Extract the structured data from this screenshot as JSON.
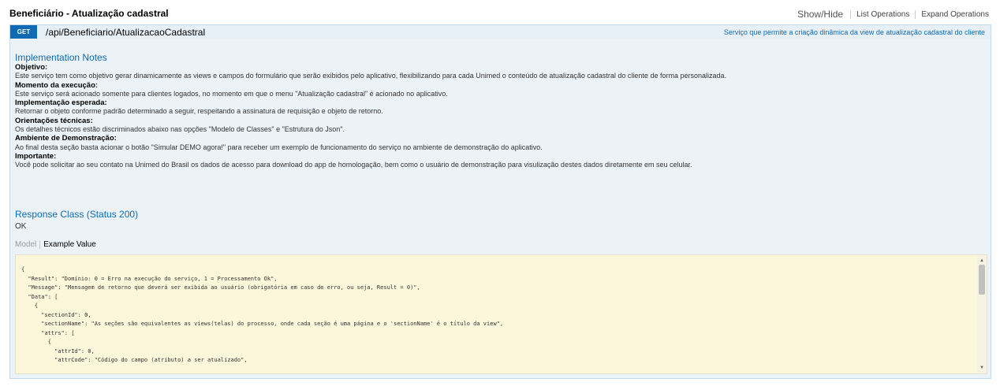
{
  "resource": {
    "title": "Beneficiário - Atualização cadastral",
    "actions": [
      "Show/Hide",
      "List Operations",
      "Expand Operations"
    ]
  },
  "operation": {
    "method": "GET",
    "path": "/api/Beneficiario/AtualizacaoCadastral",
    "summary": "Serviço que permite a criação dinâmica da view de atualização cadastral do cliente",
    "method_color": "#0f6ab4"
  },
  "notes": {
    "heading": "Implementation Notes",
    "sections": [
      {
        "label": "Objetivo:",
        "text": "Este serviço tem como objetivo gerar dinamicamente as views e campos do formulário que serão exibidos pelo aplicativo, flexibilizando para cada Unimed o conteúdo de atualização cadastral do cliente de forma personalizada."
      },
      {
        "label": "Momento da execução:",
        "text": "Este serviço será acionado somente para clientes logados, no momento em que o menu \"Atualização cadastral\" é acionado no aplicativo."
      },
      {
        "label": "Implementação esperada:",
        "text": "Retornar o objeto conforme padrão determinado a seguir, respeitando a assinatura de requisição e objeto de retorno."
      },
      {
        "label": "Orientações técnicas:",
        "text": "Os detalhes técnicos estão discriminados abaixo nas opções \"Modelo de Classes\" e \"Estrutura do Json\"."
      },
      {
        "label": "Ambiente de Demonstração:",
        "text": "Ao final desta seção basta acionar o botão \"Simular DEMO agora!\" para receber um exemplo de funcionamento do serviço no ambiente de demonstração do aplicativo."
      },
      {
        "label": "Importante:",
        "text": "Você pode solicitar ao seu contato na Unimed do Brasil os dados de acesso para download do app de homologação, bem como o usuário de demonstração para visulização destes dados diretamente em seu celular."
      }
    ]
  },
  "response": {
    "heading": "Response Class (Status 200)",
    "status_text": "OK",
    "tabs": {
      "model": "Model",
      "example": "Example Value"
    },
    "example_lines": [
      "{",
      "  \"Result\": \"Domínio: 0 = Erro na execução do serviço, 1 = Processamento Ok\",",
      "  \"Message\": \"Mensagem de retorno que deverá ser exibida ao usuário (obrigatória em caso de erro, ou seja, Result = 0)\",",
      "  \"Data\": [",
      "    {",
      "      \"sectionId\": 0,",
      "      \"sectionName\": \"As seções são equivalentes as views(telas) do processo, onde cada seção é uma página e o 'sectionName' é o título da view\",",
      "      \"attrs\": [",
      "        {",
      "          \"attrId\": 0,",
      "          \"attrCode\": \"Código do campo (atributo) a ser atualizado\","
    ]
  },
  "icons": {
    "scroll_up": "up-arrow-icon",
    "scroll_down": "down-arrow-icon"
  }
}
